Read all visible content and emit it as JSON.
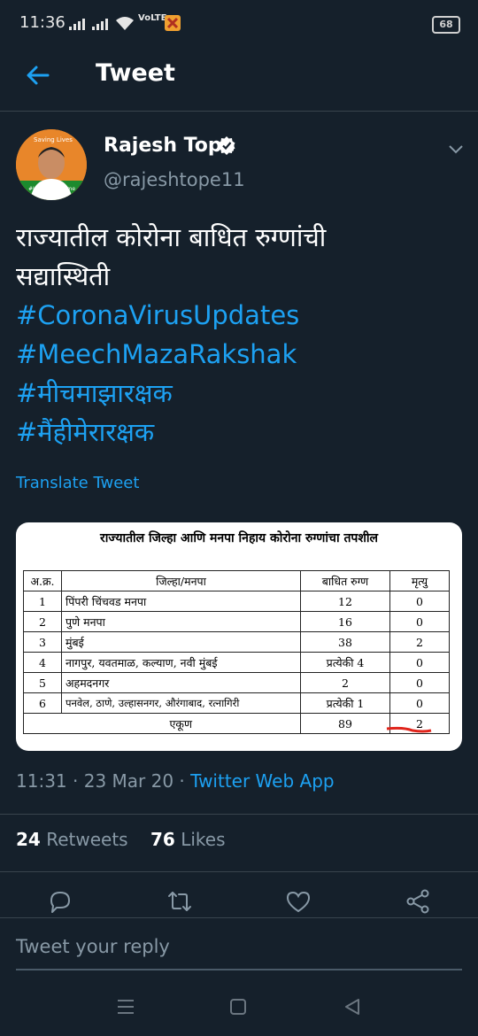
{
  "status": {
    "time": "11:36",
    "indicators": "VoLTE",
    "battery": "68"
  },
  "header": {
    "title": "Tweet"
  },
  "author": {
    "name": "Rajesh Tope",
    "handle": "@rajeshtope11",
    "avatar_text_top": "Saving Lives",
    "avatar_text_bottom": "#ImStayingHome"
  },
  "tweet": {
    "line1": "राज्यातील कोरोना बाधित रुग्णांची",
    "line2": "सद्यास्थिती",
    "hashtags": [
      "#CoronaVirusUpdates",
      "#MeechMazaRakshak",
      "#मीचमाझारक्षक",
      "#मैंहीमेरारक्षक"
    ],
    "translate": "Translate Tweet"
  },
  "image": {
    "title": "राज्यातील जिल्हा आणि मनपा निहाय कोरोना रुग्णांचा तपशील",
    "headers": [
      "अ.क्र.",
      "जिल्हा/मनपा",
      "बाधित रुग्ण",
      "मृत्यु"
    ],
    "rows": [
      [
        "1",
        "पिंपरी चिंचवड मनपा",
        "12",
        "0"
      ],
      [
        "2",
        "पुणे मनपा",
        "16",
        "0"
      ],
      [
        "3",
        "मुंबई",
        "38",
        "2"
      ],
      [
        "4",
        "नागपुर, यवतमाळ, कल्याण, नवी मुंबई",
        "प्रत्येकी 4",
        "0"
      ],
      [
        "5",
        "अहमदनगर",
        "2",
        "0"
      ],
      [
        "6",
        "पनवेल, ठाणे, उल्हासनगर, औरंगाबाद, रत्नागिरी",
        "प्रत्येकी 1",
        "0"
      ]
    ],
    "total": [
      "एकूण",
      "89",
      "2"
    ]
  },
  "meta": {
    "time": "11:31",
    "date": "23 Mar 20",
    "app": "Twitter Web App"
  },
  "stats": {
    "retweets": "24",
    "retweets_label": "Retweets",
    "likes": "76",
    "likes_label": "Likes"
  },
  "reply": {
    "placeholder": "Tweet your reply"
  },
  "colors": {
    "background": "#15202b",
    "accent": "#1da1f2",
    "muted": "#8899a6"
  }
}
